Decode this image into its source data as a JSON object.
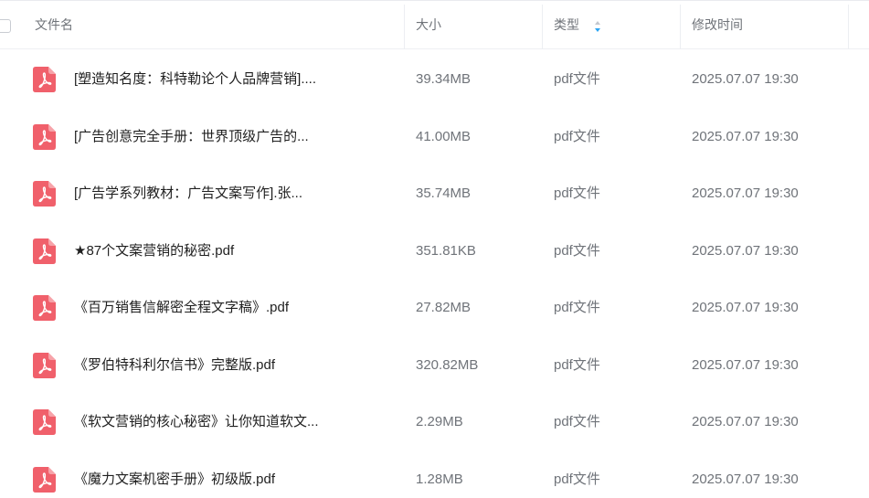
{
  "header": {
    "name": "文件名",
    "size": "大小",
    "type": "类型",
    "modified": "修改时间"
  },
  "colors": {
    "pdf_red": "#f0606b",
    "sort_active": "#2aa4f4"
  },
  "icons": {
    "file": "pdf-file-icon",
    "sort": "sort-icon"
  },
  "rows": [
    {
      "name": "[塑造知名度：科特勒论个人品牌营销]....",
      "size": "39.34MB",
      "type": "pdf文件",
      "modified": "2025.07.07 19:30"
    },
    {
      "name": "[广告创意完全手册：世界顶级广告的...",
      "size": "41.00MB",
      "type": "pdf文件",
      "modified": "2025.07.07 19:30"
    },
    {
      "name": "[广告学系列教材：广告文案写作].张...",
      "size": "35.74MB",
      "type": "pdf文件",
      "modified": "2025.07.07 19:30"
    },
    {
      "name": "★87个文案营销的秘密.pdf",
      "size": "351.81KB",
      "type": "pdf文件",
      "modified": "2025.07.07 19:30"
    },
    {
      "name": "《百万销售信解密全程文字稿》.pdf",
      "size": "27.82MB",
      "type": "pdf文件",
      "modified": "2025.07.07 19:30"
    },
    {
      "name": "《罗伯特科利尔信书》完整版.pdf",
      "size": "320.82MB",
      "type": "pdf文件",
      "modified": "2025.07.07 19:30"
    },
    {
      "name": "《软文营销的核心秘密》让你知道软文...",
      "size": "2.29MB",
      "type": "pdf文件",
      "modified": "2025.07.07 19:30"
    },
    {
      "name": "《魔力文案机密手册》初级版.pdf",
      "size": "1.28MB",
      "type": "pdf文件",
      "modified": "2025.07.07 19:30"
    }
  ]
}
